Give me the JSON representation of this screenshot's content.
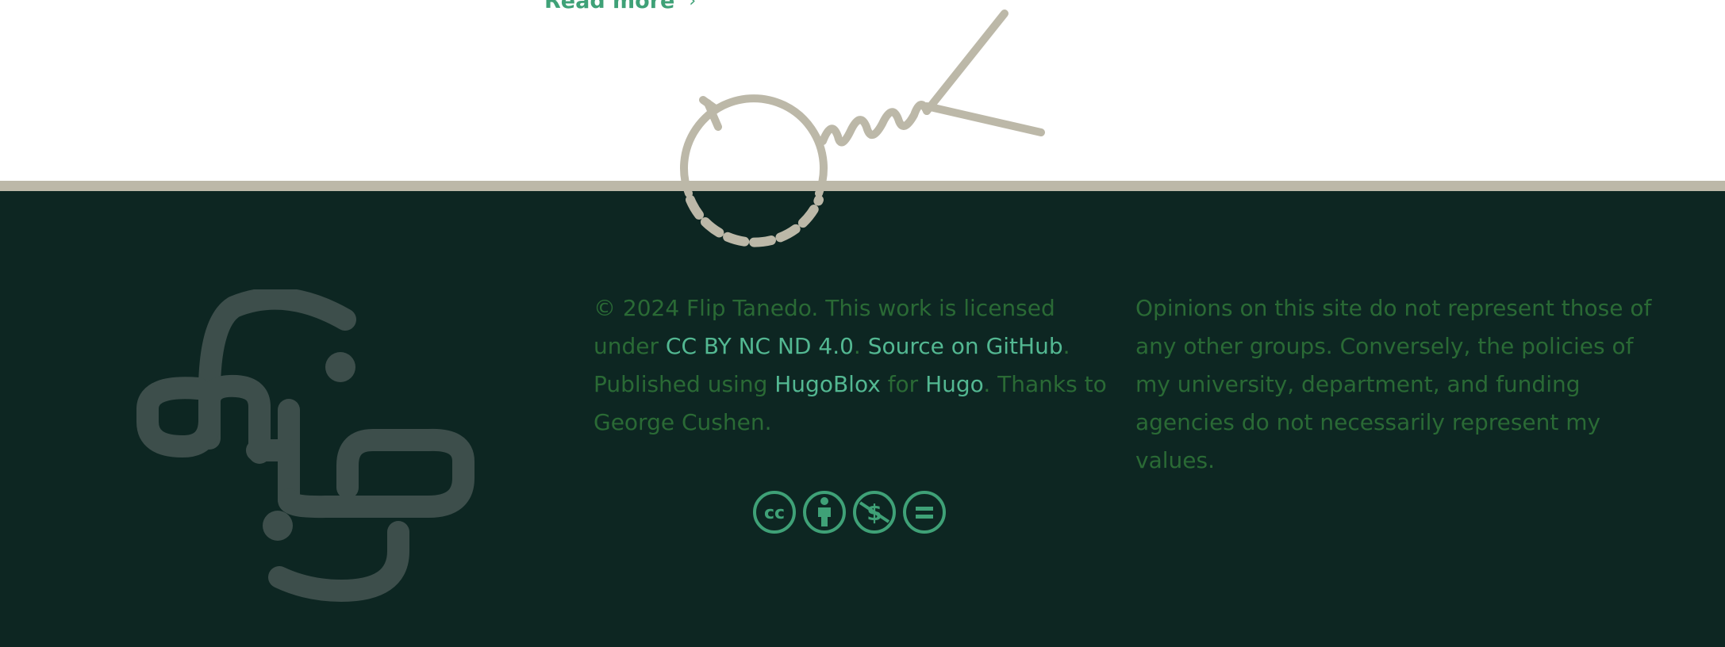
{
  "article": {
    "read_more_label": "Read more",
    "read_more_chevron": "›"
  },
  "footer": {
    "copyright_text": "© 2024 Flip Tanedo. This work is licensed under ",
    "license_link": "CC BY NC ND 4.0",
    "sep1": ". ",
    "source_link": "Source on GitHub",
    "published_text": ". Published using ",
    "hugoblox_link": "HugoBlox",
    "for_text": " for ",
    "hugo_link": "Hugo",
    "thanks_text": ". Thanks to George Cushen.",
    "disclaimer": "Opinions on this site do not represent those of any other groups. Conversely, the policies of my university, department, and funding agencies do not necessarily represent my values."
  },
  "icons": {
    "license_icons": [
      "creative-commons-icon",
      "attribution-icon",
      "non-commercial-icon",
      "no-derivatives-icon"
    ]
  },
  "colors": {
    "footer_bg": "#0d2622",
    "band": "#bcb8a8",
    "muted_text": "#2a6a35",
    "link": "#53b892",
    "accent": "#3fa177",
    "logo": "#3d4e4b"
  }
}
